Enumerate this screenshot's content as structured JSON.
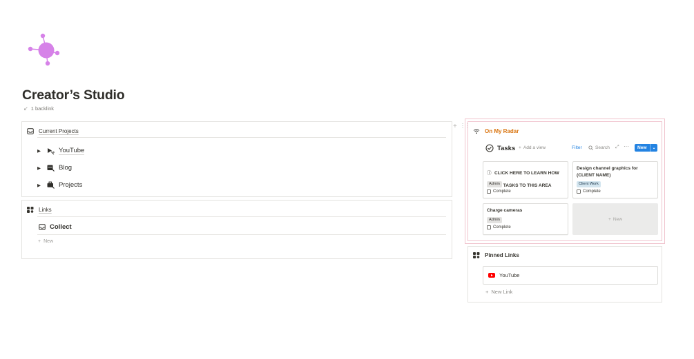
{
  "page": {
    "title": "Creator’s Studio",
    "backlink": "1 backlink"
  },
  "current_projects": {
    "header": "Current Projects",
    "items": [
      {
        "label": "YouTube",
        "icon": "play-cursor-icon"
      },
      {
        "label": "Blog",
        "icon": "calendar-edit-icon"
      },
      {
        "label": "Projects",
        "icon": "briefcase-edit-icon"
      }
    ]
  },
  "links": {
    "header": "Links",
    "collect": "Collect",
    "new_label": "New"
  },
  "radar": {
    "title": "On My Radar",
    "db_title": "Tasks",
    "add_view": "Add a view",
    "filter": "Filter",
    "search": "Search",
    "new_button": "New",
    "cards": [
      {
        "title": "CLICK HERE TO LEARN HOW TO PIN TASKS TO THIS AREA",
        "tag": "Admin",
        "check": "Complete"
      },
      {
        "title": "Design channel graphics for (CLIENT NAME)",
        "tag": "Client Work",
        "check": "Complete"
      },
      {
        "title": "Charge cameras",
        "tag": "Admin",
        "check": "Complete"
      }
    ],
    "placeholder_new": "New"
  },
  "pinned": {
    "header": "Pinned Links",
    "item": "YouTube",
    "new_link": "New Link"
  },
  "colors": {
    "accent_blue": "#2383e2",
    "radar_orange": "#d9730d",
    "logo_purple": "#d682e8",
    "youtube_red": "#ff0000"
  }
}
